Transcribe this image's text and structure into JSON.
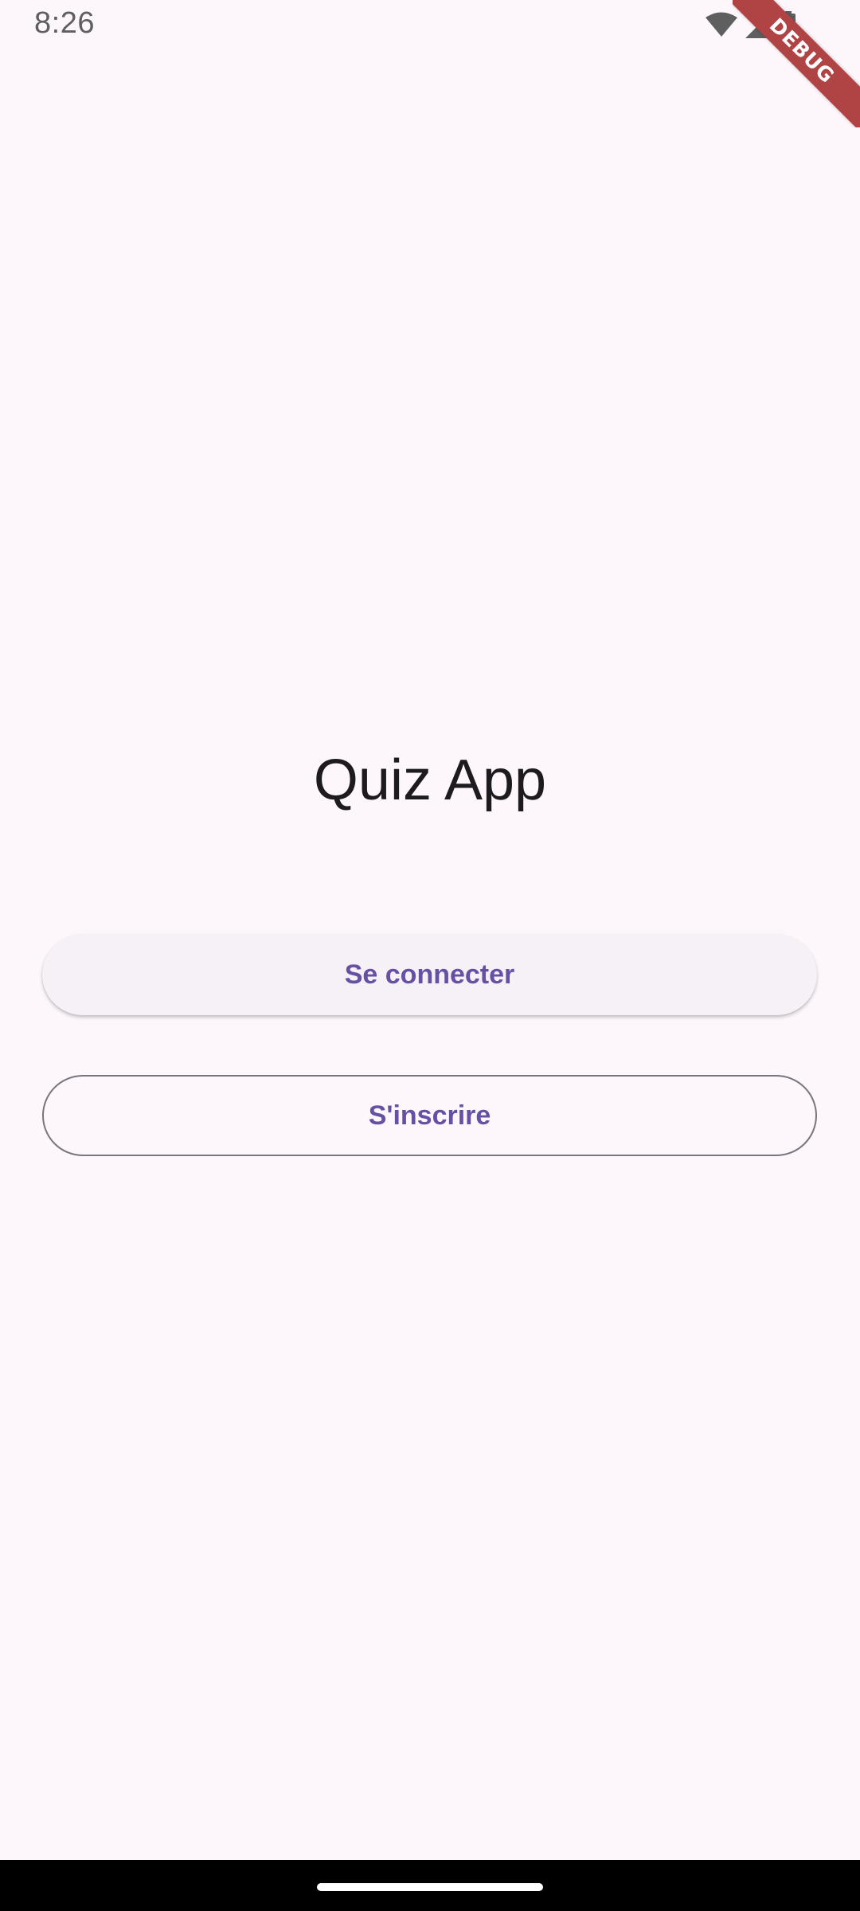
{
  "status_bar": {
    "time": "8:26",
    "icons": [
      "wifi-icon",
      "cellular-signal-icon",
      "battery-icon"
    ]
  },
  "debug_banner": {
    "label": "DEBUG",
    "color": "#b04444"
  },
  "main": {
    "title": "Quiz App",
    "buttons": {
      "login_label": "Se connecter",
      "signup_label": "S'inscrire"
    }
  },
  "colors": {
    "background": "#fdf7fc",
    "primary": "#6750a4",
    "outline": "#79747e",
    "on_surface": "#1d1b20"
  }
}
